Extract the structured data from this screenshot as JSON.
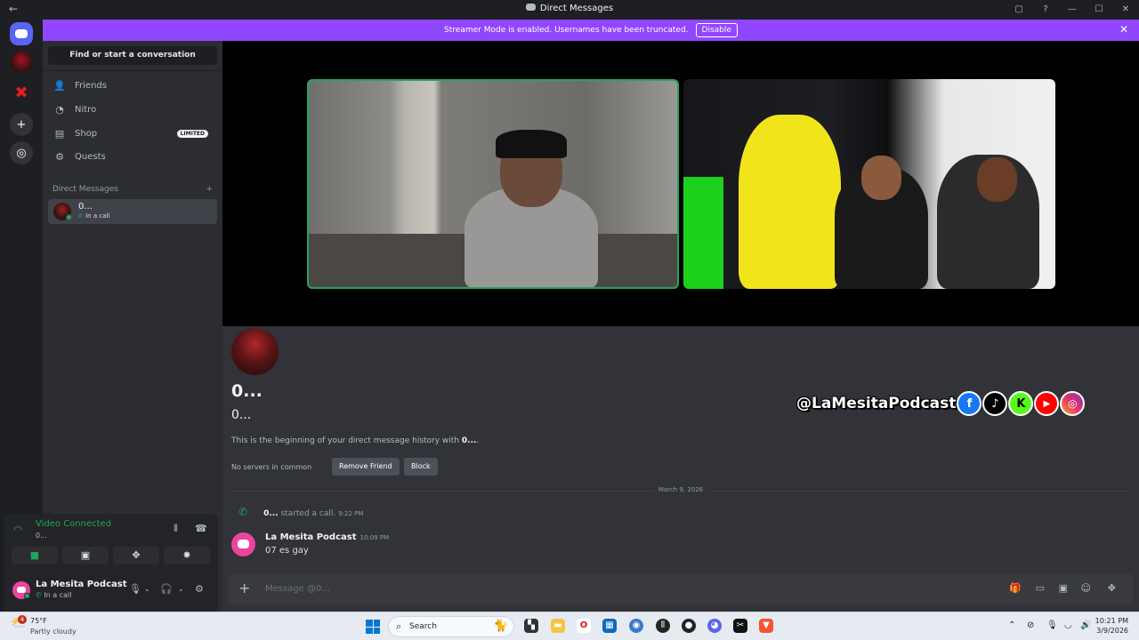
{
  "window": {
    "title": "Direct Messages",
    "back": "←",
    "controls": [
      "▢",
      "?",
      "—",
      "☐",
      "✕"
    ]
  },
  "banner": {
    "text": "Streamer Mode is enabled. Usernames have been truncated.",
    "button": "Disable",
    "close": "✕"
  },
  "rail": {
    "add": "+",
    "explore": "◎"
  },
  "sidebar": {
    "search_label": "Find or start a conversation",
    "nav": [
      {
        "label": "Friends",
        "icon": "friends-icon"
      },
      {
        "label": "Nitro",
        "icon": "nitro-icon"
      },
      {
        "label": "Shop",
        "icon": "shop-icon",
        "badge": "LIMITED"
      },
      {
        "label": "Quests",
        "icon": "quests-icon"
      }
    ],
    "dm_header": "Direct Messages",
    "dm_add": "+",
    "dm": {
      "name": "0...",
      "status": "In a call"
    }
  },
  "voice": {
    "status": "Video Connected",
    "channel": "0..."
  },
  "user": {
    "name": "La Mesita Podcast",
    "status": "In a call"
  },
  "overlay": {
    "handle": "@LaMesitaPodcast"
  },
  "profile": {
    "display_name": "0...",
    "username": "0...",
    "intro_prefix": "This is the beginning of your direct message history with ",
    "intro_name": "0...",
    "intro_suffix": ".",
    "no_servers": "No servers in common",
    "remove_friend": "Remove Friend",
    "block": "Block"
  },
  "messages": {
    "date_divider": "March 9, 2026",
    "system": {
      "author": "0...",
      "text": " started a call.",
      "time": "9:22 PM"
    },
    "items": [
      {
        "author": "La Mesita Podcast",
        "time": "10:09 PM",
        "text": "07 es gay"
      }
    ]
  },
  "composer": {
    "placeholder": "Message @0..."
  },
  "taskbar": {
    "weather": {
      "temp": "75°F",
      "condition": "Partly cloudy",
      "badge": "4"
    },
    "search_label": "Search",
    "time": "10:21 PM",
    "date": "3/9/2026"
  },
  "colors": {
    "accent": "#5865f2",
    "banner": "#9147ff",
    "green": "#23a55a",
    "pink": "#eb459e"
  }
}
